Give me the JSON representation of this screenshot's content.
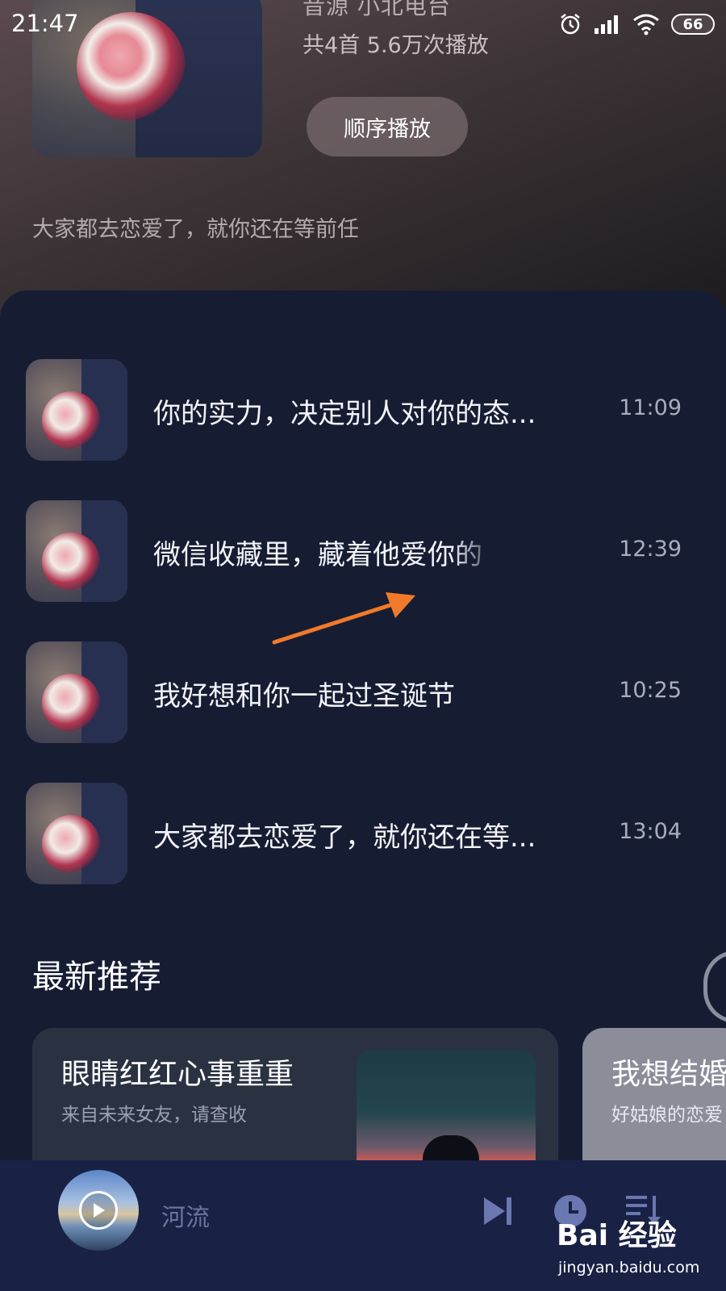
{
  "status_bar": {
    "time": "21:47",
    "battery": "66",
    "icons": [
      "alarm-icon",
      "signal-icon",
      "wifi-icon",
      "battery-icon"
    ]
  },
  "album": {
    "source_line": "音源  小北电台",
    "stats": "共4首   5.6万次播放",
    "play_button": "顺序播放",
    "description": "大家都去恋爱了，就你还在等前任"
  },
  "tracks": [
    {
      "title": "你的实力，决定别人对你的态...",
      "duration": "11:09"
    },
    {
      "title": "微信收藏里，藏着他爱你的",
      "duration": "12:39"
    },
    {
      "title": "我好想和你一起过圣诞节",
      "duration": "10:25"
    },
    {
      "title": "大家都去恋爱了，就你还在等...",
      "duration": "13:04"
    }
  ],
  "recommend": {
    "title": "最新推荐",
    "cards": [
      {
        "title": "眼睛红红心事重重",
        "subtitle": "来自未来女友，请查收"
      },
      {
        "title": "我想结婚",
        "subtitle": "好姑娘的恋爱"
      }
    ]
  },
  "player": {
    "track": "河流"
  },
  "watermark": {
    "logo": "Bai 经验",
    "url": "jingyan.baidu.com"
  },
  "colors": {
    "background": "#161d33",
    "player_bar": "#192145",
    "annotation_arrow": "#f07a2a"
  }
}
